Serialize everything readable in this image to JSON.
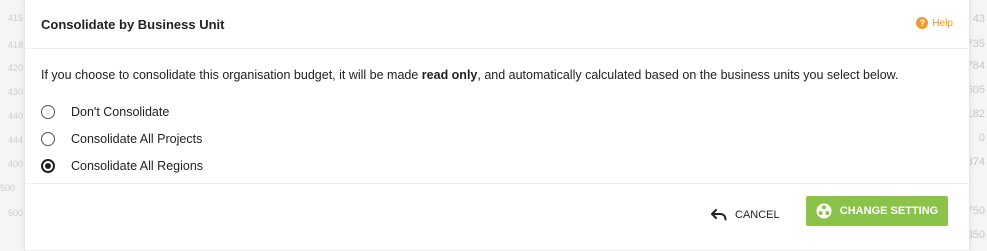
{
  "background": {
    "left_numbers": [
      "415",
      "418",
      "420",
      "430",
      "440",
      "444",
      "400",
      "500",
      "500"
    ],
    "right_numbers": [
      "43",
      "735",
      "784",
      "605",
      "182",
      "0",
      "874",
      "750",
      "850"
    ]
  },
  "dialog": {
    "title": "Consolidate by Business Unit",
    "help_label": "Help",
    "description_prefix": "If you choose to consolidate this organisation budget, it will be made ",
    "description_bold": "read only",
    "description_suffix": ", and automatically calculated based on the business units you select below.",
    "options": [
      {
        "label": "Don't Consolidate",
        "checked": false
      },
      {
        "label": "Consolidate All Projects",
        "checked": false
      },
      {
        "label": "Consolidate All Regions",
        "checked": true
      }
    ],
    "cancel_label": "CANCEL",
    "confirm_label": "CHANGE SETTING"
  },
  "colors": {
    "accent_green": "#8bc34a",
    "help_orange": "#ee9a2c"
  }
}
